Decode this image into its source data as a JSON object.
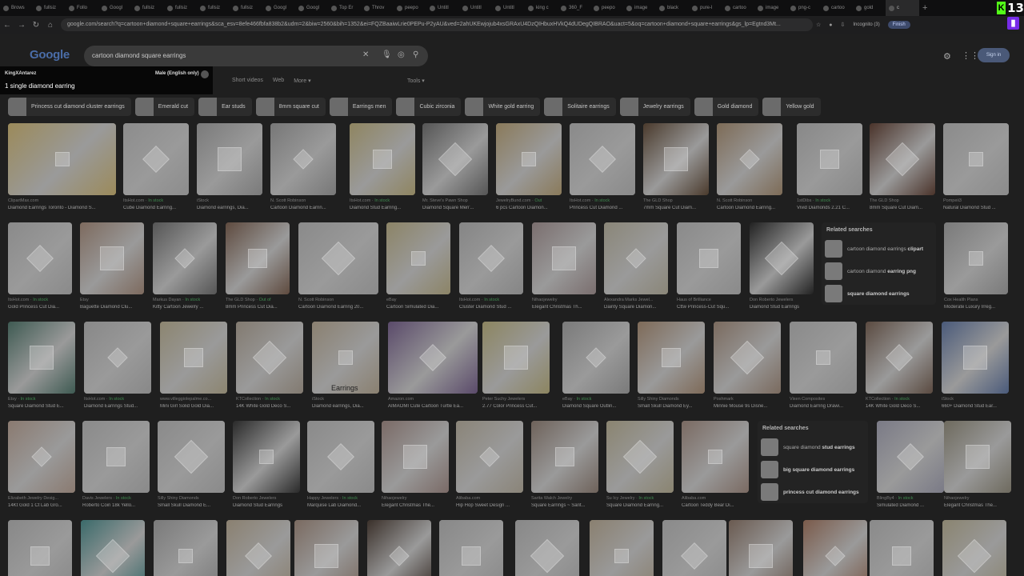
{
  "tabs": [
    {
      "label": "Brows",
      "icon": "kick-icon",
      "active": false
    },
    {
      "label": "fullsiz",
      "icon": "image-icon",
      "active": false
    },
    {
      "label": "Follo",
      "icon": "kick-icon",
      "active": false
    },
    {
      "label": "Googl",
      "icon": "google-icon",
      "active": false
    },
    {
      "label": "fullsiz",
      "icon": "image-icon",
      "active": false
    },
    {
      "label": "fullsiz",
      "icon": "image-icon",
      "active": false
    },
    {
      "label": "fullsiz",
      "icon": "image-icon",
      "active": false
    },
    {
      "label": "fullsiz",
      "icon": "image-icon",
      "active": false
    },
    {
      "label": "Googl",
      "icon": "google-icon",
      "active": false
    },
    {
      "label": "Googl",
      "icon": "google-icon",
      "active": false
    },
    {
      "label": "Top Er",
      "icon": "page-icon",
      "active": false
    },
    {
      "label": "Throv",
      "icon": "page-icon",
      "active": false
    },
    {
      "label": "peepo",
      "icon": "image-icon",
      "active": false
    },
    {
      "label": "Untitl",
      "icon": "page-icon",
      "active": false
    },
    {
      "label": "Untitl",
      "icon": "page-icon",
      "active": false
    },
    {
      "label": "Untitl",
      "icon": "page-icon",
      "active": false
    },
    {
      "label": "king c",
      "icon": "image-icon",
      "active": false
    },
    {
      "label": "360_F",
      "icon": "image-icon",
      "active": false
    },
    {
      "label": "peepo",
      "icon": "image-icon",
      "active": false
    },
    {
      "label": "image",
      "icon": "image-icon",
      "active": false
    },
    {
      "label": "black",
      "icon": "image-icon",
      "active": false
    },
    {
      "label": "pure-l",
      "icon": "image-icon",
      "active": false
    },
    {
      "label": "cartoo",
      "icon": "google-icon",
      "active": false
    },
    {
      "label": "image",
      "icon": "image-icon",
      "active": false
    },
    {
      "label": "png-c",
      "icon": "image-icon",
      "active": false
    },
    {
      "label": "cartoo",
      "icon": "google-icon",
      "active": false
    },
    {
      "label": "gold",
      "icon": "image-icon",
      "active": false
    },
    {
      "label": "c",
      "icon": "google-icon",
      "active": true
    }
  ],
  "new_tab_label": "+",
  "kick_badge": {
    "label": "K",
    "count": "13"
  },
  "address": {
    "url": "google.com/search?q=cartoon+diamond+square+earrings&sca_esv=8efe466fbfa838b2&udm=2&biw=2560&bih=1352&ei=FQZBaaiwLrie0PEPu-P2yAU&ved=2ahUKEwjojub4xsGRAxU4DzQIHbuxHVkQ4dUDegQIBRAO&uact=5&oq=cartoon+diamond+square+earrings&gs_lp=Egtnd3Mt...",
    "incognito": "Incognito (3)",
    "finish": "Finish"
  },
  "google": {
    "logo": "Google",
    "query": "cartoon diamond square earrings",
    "signin": "Sign in"
  },
  "twitch_overlay": {
    "user": "KingXAntarez",
    "voice": "Male (English only)",
    "message": "1 single diamond earring"
  },
  "filters": [
    "Short videos",
    "Web",
    "More ▾"
  ],
  "tools": "Tools ▾",
  "chips": [
    "Princess cut diamond cluster earrings",
    "Emerald cut",
    "Ear studs",
    "8mm square cut",
    "Earrings men",
    "Cubic zirconia",
    "White gold earring",
    "Solitaire earrings",
    "Jewelry earrings",
    "Gold diamond",
    "Yellow gold"
  ],
  "colors": {
    "page_bg": "#1f1f1f",
    "chip_bg": "#2c2c2c",
    "in_stock": "#3f8a4f",
    "brand_kick": "#53fc18",
    "twitch": "#772ce8"
  },
  "rows": [
    [
      {
        "src": "ClipartMax.com",
        "stock": "",
        "title": "Diamond Earrings Toronto - Diamond S...",
        "tone": "#9b8a5a"
      },
      {
        "src": "ItsHot.com",
        "stock": "In stock",
        "title": "Cube Diamond Earring...",
        "tone": "#8c8c8c"
      },
      {
        "src": "iStock",
        "stock": "",
        "title": "Diamond earrings, Dia...",
        "tone": "#7a7a7a"
      },
      {
        "src": "N. Scott Robinson",
        "stock": "",
        "title": "Cartoon Diamond Earrin...",
        "tone": "#777"
      },
      {
        "src": "ItsHot.com",
        "stock": "In stock",
        "title": "Diamond Stud Earring...",
        "tone": "#8f8560"
      },
      {
        "src": "Mr. Steve's Pawn Shop",
        "stock": "",
        "title": "Diamond Square Men'...",
        "tone": "#555"
      },
      {
        "src": "JewelryBund.com",
        "stock": "Out",
        "title": "6 pcs Cartoon Diamon...",
        "tone": "#8a7a5a"
      },
      {
        "src": "ItsHot.com",
        "stock": "In stock",
        "title": "Princess Cut Diamond ...",
        "tone": "#8a8a8a"
      },
      {
        "src": "The GLD Shop",
        "stock": "",
        "title": "7mm Square Cut Diam...",
        "tone": "#4a3a2c"
      },
      {
        "src": "N. Scott Robinson",
        "stock": "",
        "title": "Cartoon Diamond Earring...",
        "tone": "#7d6b56"
      },
      {
        "src": "1stDibs",
        "stock": "In stock",
        "title": "Vivid Diamonds 2.21 C...",
        "tone": "#888"
      },
      {
        "src": "The GLD Shop",
        "stock": "",
        "title": "8mm Square Cut Diam...",
        "tone": "#4a332a"
      },
      {
        "src": "Pompeii3",
        "stock": "",
        "title": "Natural Diamond Stud ...",
        "tone": "#8b8b8b"
      }
    ],
    [
      {
        "src": "ItsHot.com",
        "stock": "In stock",
        "title": "Gold Princess Cut Dia...",
        "tone": "#8a8a8a"
      },
      {
        "src": "Etsy",
        "stock": "",
        "title": "Baguette Diamond Clu...",
        "tone": "#7d6a5e"
      },
      {
        "src": "Markus Dayan",
        "stock": "In stock",
        "title": "Kitty Cartoon Jewelry ...",
        "tone": "#555"
      },
      {
        "src": "The GLD Shop",
        "stock": "Out of",
        "title": "8mm Princess Cut Dia...",
        "tone": "#5e4a3e"
      },
      {
        "src": "N. Scott Robinson",
        "stock": "",
        "title": "Cartoon Diamond Earring 20...",
        "tone": "#8a8a8a"
      },
      {
        "src": "eBay",
        "stock": "",
        "title": "Cartoon Simulated Dia...",
        "tone": "#8c8466"
      },
      {
        "src": "ItsHot.com",
        "stock": "In stock",
        "title": "Cluster Diamond Stud ...",
        "tone": "#858585"
      },
      {
        "src": "Nihaojewelry",
        "stock": "",
        "title": "Elegant Christmas Th...",
        "tone": "#7a6e6e"
      },
      {
        "src": "Alexandra Marks Jewel...",
        "stock": "",
        "title": "Dainty Square Diamon...",
        "tone": "#8a8678"
      },
      {
        "src": "Haus of Brilliance",
        "stock": "",
        "title": "Cttw Princess-Cut Squ...",
        "tone": "#8a8a8a"
      },
      {
        "src": "Don Roberto Jewelers",
        "stock": "",
        "title": "Diamond Stud Earrings",
        "tone": "#222"
      },
      {
        "src": "Cox Health Plans",
        "stock": "",
        "title": "Moderate Luxury Irreg...",
        "tone": "#7a7a7a"
      }
    ],
    [
      {
        "src": "Etsy",
        "stock": "In stock",
        "title": "Square Diamond Stud E...",
        "tone": "#3e5a52"
      },
      {
        "src": "ItsHot.com",
        "stock": "In stock",
        "title": "Diamond Earrings Stud...",
        "tone": "#888"
      },
      {
        "src": "www.villeggiolepalme.co...",
        "stock": "",
        "title": "Mini Girl Solid Gold Dia...",
        "tone": "#8c8570"
      },
      {
        "src": "KTCollection",
        "stock": "In stock",
        "title": "14K White Gold Deco S...",
        "tone": "#827a70"
      },
      {
        "src": "iStock",
        "stock": "",
        "title": "Diamond earrings, Dia...",
        "tone": "#8a8070",
        "badge": "Earrings"
      },
      {
        "src": "Amazon.com",
        "stock": "",
        "title": "AIMAOMI Cute Cartoon Turtle Ea...",
        "tone": "#5a4a6a"
      },
      {
        "src": "Peter Suchy Jewelers",
        "stock": "",
        "title": "2.77 Color Princess Cut...",
        "tone": "#8c8560"
      },
      {
        "src": "eBay",
        "stock": "In stock",
        "title": "Diamond Square Outlin...",
        "tone": "#7a7a7a"
      },
      {
        "src": "Silly Shiny Diamonds",
        "stock": "",
        "title": "Small Skull Diamond Ey...",
        "tone": "#7e6a58"
      },
      {
        "src": "Poshmark",
        "stock": "",
        "title": "Minnie Mouse 9s Disne...",
        "tone": "#7a6a5e"
      },
      {
        "src": "Vixen Composites",
        "stock": "",
        "title": "Diamond Earring Drawi...",
        "tone": "#8a8a8a"
      },
      {
        "src": "KTCollection",
        "stock": "In stock",
        "title": "14K White Gold Deco S...",
        "tone": "#5a4a40"
      },
      {
        "src": "iStock",
        "stock": "",
        "title": "660+ Diamond Stud Ear...",
        "tone": "#4a5a7a"
      }
    ],
    [
      {
        "src": "Elizabeth Jewelry Desig...",
        "stock": "",
        "title": "14Kt Gold 1 Ct Lab Gro...",
        "tone": "#8a7a70"
      },
      {
        "src": "Davis Jewelers",
        "stock": "In stock",
        "title": "Roberto Coin 18k Yello...",
        "tone": "#8a8a8a"
      },
      {
        "src": "Silly Shiny Diamonds",
        "stock": "",
        "title": "Small Skull Diamond E...",
        "tone": "#8a8a8a"
      },
      {
        "src": "Don Roberto Jewelers",
        "stock": "",
        "title": "Diamond Stud Earrings",
        "tone": "#2a2a2a"
      },
      {
        "src": "Happy Jewelers",
        "stock": "In stock",
        "title": "Marquise Lab Diamond...",
        "tone": "#8a8a8a"
      },
      {
        "src": "Nihaojewelry",
        "stock": "",
        "title": "Elegant Christmas The...",
        "tone": "#7a6a66"
      },
      {
        "src": "Alibaba.com",
        "stock": "",
        "title": "Hip Hop Sweet Design ...",
        "tone": "#8a8478"
      },
      {
        "src": "Sarita Walch Jewelry",
        "stock": "",
        "title": "Square Earrings ~ Sarit...",
        "tone": "#6e625a"
      },
      {
        "src": "Su Icy Jewelry",
        "stock": "In stock",
        "title": "Square Diamond Earring...",
        "tone": "#8a8470"
      },
      {
        "src": "Alibaba.com",
        "stock": "",
        "title": "Cartoon Teddy Bear Di...",
        "tone": "#7a6a62"
      },
      {
        "src": "BlingBy4",
        "stock": "In stock",
        "title": "Simulated Diamond ...",
        "tone": "#7a7a86"
      },
      {
        "src": "Nihaojewelry",
        "stock": "",
        "title": "Elegant Christmas The...",
        "tone": "#6e6a5e"
      }
    ],
    [
      {
        "tone": "#888"
      },
      {
        "tone": "#3a6a6a"
      },
      {
        "tone": "#7a7a7a"
      },
      {
        "tone": "#8a8070"
      },
      {
        "tone": "#7a6a60"
      },
      {
        "tone": "#3a302a"
      },
      {
        "tone": "#888"
      },
      {
        "tone": "#888"
      },
      {
        "tone": "#8a8070"
      },
      {
        "tone": "#8a8a8a"
      },
      {
        "tone": "#6a5a50"
      },
      {
        "tone": "#7a5a4a"
      },
      {
        "tone": "#8a8a8a"
      },
      {
        "tone": "#8a8470"
      }
    ]
  ],
  "related_1": {
    "heading": "Related searches",
    "items": [
      {
        "pre": "cartoon diamond earrings ",
        "bold": "clipart"
      },
      {
        "pre": "cartoon diamond ",
        "bold": "earring png"
      },
      {
        "pre": "",
        "bold": "square diamond earrings"
      }
    ]
  },
  "related_2": {
    "heading": "Related searches",
    "items": [
      {
        "pre": "square diamond ",
        "bold": "stud earrings"
      },
      {
        "pre": "",
        "bold": "big square diamond earrings"
      },
      {
        "pre": "",
        "bold": "princess cut diamond earrings"
      }
    ]
  }
}
